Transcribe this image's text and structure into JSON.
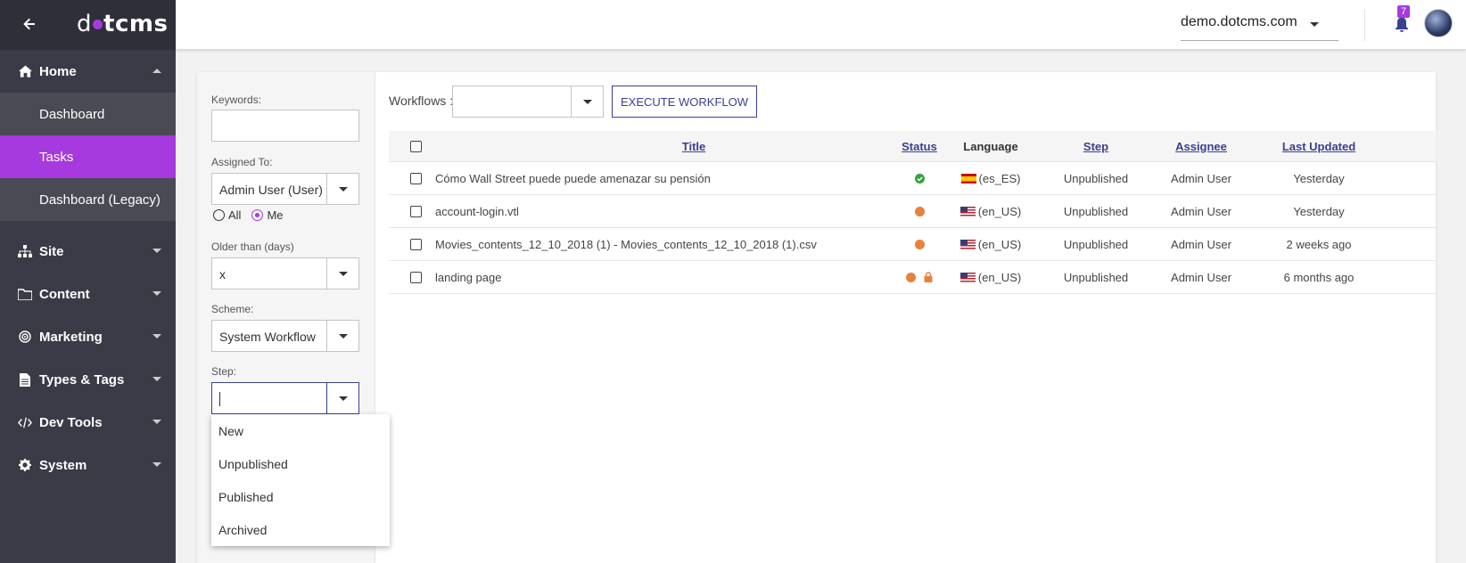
{
  "colors": {
    "accent": "#a63ade",
    "primary": "#3a3f8f",
    "sidebar": "#3b3b47",
    "status_orange": "#e8813a",
    "status_green": "#3aa040"
  },
  "brand": {
    "logo_left": "d",
    "logo_right": "tcms"
  },
  "sidebar": {
    "home": {
      "label": "Home",
      "icon": "home-icon",
      "items": [
        "Dashboard",
        "Tasks",
        "Dashboard (Legacy)"
      ],
      "active": "Tasks"
    },
    "groups": [
      {
        "label": "Site",
        "icon": "site-icon"
      },
      {
        "label": "Content",
        "icon": "folder-icon"
      },
      {
        "label": "Marketing",
        "icon": "target-icon"
      },
      {
        "label": "Types & Tags",
        "icon": "file-icon"
      },
      {
        "label": "Dev Tools",
        "icon": "code-icon"
      },
      {
        "label": "System",
        "icon": "gear-icon"
      }
    ]
  },
  "header": {
    "site": "demo.dotcms.com",
    "notifications": "7"
  },
  "filters": {
    "keywords_label": "Keywords:",
    "keywords_value": "",
    "assigned_label": "Assigned To:",
    "assigned_value": "Admin User (User)",
    "radio_all": "All",
    "radio_me": "Me",
    "older_label": "Older than (days)",
    "older_value": "x",
    "scheme_label": "Scheme:",
    "scheme_value": "System Workflow",
    "step_label": "Step:",
    "step_value": "",
    "step_options": [
      "New",
      "Unpublished",
      "Published",
      "Archived"
    ]
  },
  "toolbar": {
    "workflows_label": "Workflows :",
    "execute_label": "EXECUTE WORKFLOW"
  },
  "table": {
    "headers": {
      "title": "Title",
      "status": "Status",
      "language": "Language",
      "step": "Step",
      "assignee": "Assignee",
      "updated": "Last Updated"
    },
    "rows": [
      {
        "title": "Cómo Wall Street puede puede amenazar su pensión",
        "status": "published",
        "lang": "(es_ES)",
        "step": "Unpublished",
        "assignee": "Admin User",
        "updated": "Yesterday"
      },
      {
        "title": "account-login.vtl",
        "status": "draft",
        "lang": "(en_US)",
        "step": "Unpublished",
        "assignee": "Admin User",
        "updated": "Yesterday"
      },
      {
        "title": "Movies_contents_12_10_2018 (1) - Movies_contents_12_10_2018 (1).csv",
        "status": "draft",
        "lang": "(en_US)",
        "step": "Unpublished",
        "assignee": "Admin User",
        "updated": "2 weeks ago"
      },
      {
        "title": "landing page",
        "status": "draft-locked",
        "lang": "(en_US)",
        "step": "Unpublished",
        "assignee": "Admin User",
        "updated": "6 months ago"
      }
    ]
  }
}
